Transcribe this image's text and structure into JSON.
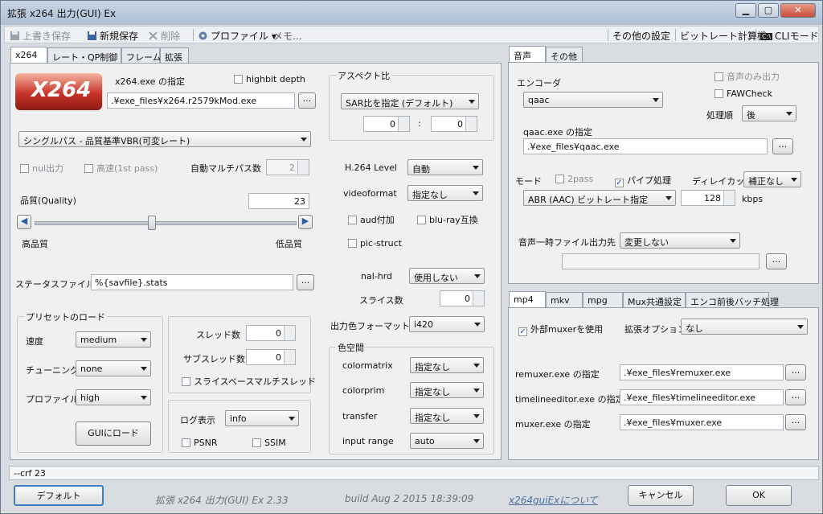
{
  "window": {
    "title": "拡張 x264 出力(GUI) Ex"
  },
  "toolbar": {
    "overwrite_save": "上書き保存",
    "new_save": "新規保存",
    "delete": "削除",
    "profile": "プロファイル",
    "memo": "メモ...",
    "other_settings": "その他の設定",
    "bitrate_calc": "ビットレート計算機",
    "cli_mode": "CLIモード",
    "cli_icon_text": "C:\\"
  },
  "left_tabs": [
    "x264",
    "レート・QP制御",
    "フレーム",
    "拡張"
  ],
  "x264": {
    "logo_text": "X264",
    "exe_label": "x264.exe の指定",
    "highbit_label": "highbit depth",
    "exe_path": ".¥exe_files¥x264.r2579kMod.exe",
    "browse": "...",
    "mode_select": "シングルパス - 品質基準VBR(可変レート)",
    "nul_output": "nul出力",
    "fast_first_pass": "高速(1st pass)",
    "auto_multipass_label": "自動マルチパス数",
    "auto_multipass_value": "2",
    "quality_label": "品質(Quality)",
    "quality_value": "23",
    "quality_slider": {
      "value": 23,
      "min": 0,
      "max": 51
    },
    "high_quality": "高品質",
    "low_quality": "低品質",
    "status_file_label": "ステータスファイル",
    "status_file_value": "%{savfile}.stats",
    "preset_group": "プリセットのロード",
    "speed_label": "速度",
    "speed_value": "medium",
    "tuning_label": "チューニング",
    "tuning_value": "none",
    "profile_label": "プロファイル",
    "profile_value": "high",
    "load_gui": "GUIにロード",
    "threads_label": "スレッド数",
    "threads_value": "0",
    "subthreads_label": "サブスレッド数",
    "subthreads_value": "0",
    "slice_multithread": "スライスベースマルチスレッド",
    "log_label": "ログ表示",
    "log_value": "info",
    "psnr": "PSNR",
    "ssim": "SSIM",
    "aspect_group": "アスペクト比",
    "aspect_select": "SAR比を指定 (デフォルト)",
    "aspect_w": "0",
    "aspect_colon": ":",
    "aspect_h": "0",
    "h264_level_label": "H.264 Level",
    "h264_level_value": "自動",
    "videoformat_label": "videoformat",
    "videoformat_value": "指定なし",
    "aud": "aud付加",
    "bluray": "blu-ray互換",
    "pic_struct": "pic-struct",
    "nal_hrd_label": "nal-hrd",
    "nal_hrd_value": "使用しない",
    "slices_label": "スライス数",
    "slices_value": "0",
    "output_color_label": "出力色フォーマット",
    "output_color_value": "i420",
    "colorspace_group": "色空間",
    "colormatrix_label": "colormatrix",
    "colormatrix_value": "指定なし",
    "colorprim_label": "colorprim",
    "colorprim_value": "指定なし",
    "transfer_label": "transfer",
    "transfer_value": "指定なし",
    "input_range_label": "input range",
    "input_range_value": "auto"
  },
  "audio_tabs": [
    "音声",
    "その他"
  ],
  "audio": {
    "encoder_label": "エンコーダ",
    "encoder_value": "qaac",
    "audio_only": "音声のみ出力",
    "faw_check": "FAWCheck",
    "order_label": "処理順",
    "order_value": "後",
    "exe_label": "qaac.exe の指定",
    "exe_path": ".¥exe_files¥qaac.exe",
    "browse": "...",
    "mode_label": "モード",
    "twopass": "2pass",
    "pipe": "パイプ処理",
    "delay_label": "ディレイカット",
    "delay_value": "補正なし",
    "mode_value": "ABR (AAC) ビットレート指定",
    "bitrate_value": "128",
    "bitrate_unit": "kbps",
    "temp_label": "音声一時ファイル出力先",
    "temp_value": "変更しない",
    "temp_path": "",
    "temp_browse": "..."
  },
  "mux_tabs": [
    "mp4",
    "mkv",
    "mpg",
    "Mux共通設定",
    "エンコ前後バッチ処理"
  ],
  "mux": {
    "external_muxer": "外部muxerを使用",
    "ext_option_label": "拡張オプション",
    "ext_option_value": "なし",
    "remuxer_label": "remuxer.exe の指定",
    "remuxer_path": ".¥exe_files¥remuxer.exe",
    "timeline_label": "timelineeditor.exe の指定",
    "timeline_path": ".¥exe_files¥timelineeditor.exe",
    "muxer_label": "muxer.exe の指定",
    "muxer_path": ".¥exe_files¥muxer.exe",
    "browse": "..."
  },
  "status": {
    "cmdline": "--crf 23"
  },
  "footer": {
    "default_btn": "デフォルト",
    "version": "拡張 x264 出力(GUI) Ex 2.33",
    "build": "build Aug  2 2015 18:39:09",
    "about": "x264guiExについて",
    "cancel": "キャンセル",
    "ok": "OK"
  },
  "colors": {
    "accent": "#3c7fc4",
    "logo": "#c8342a"
  }
}
